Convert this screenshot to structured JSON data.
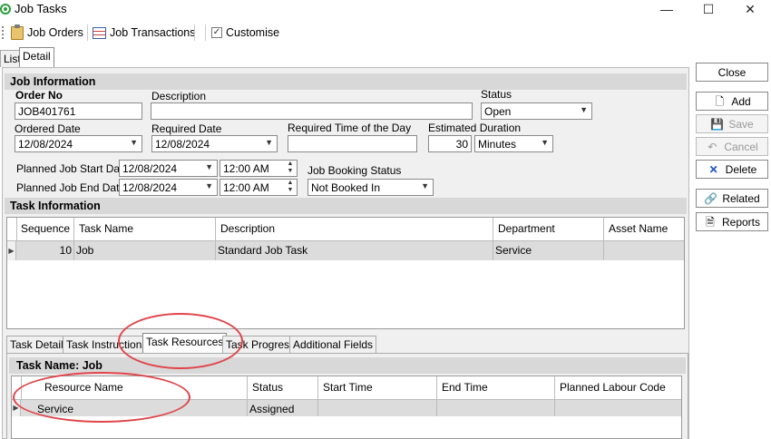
{
  "window": {
    "title": "Job Tasks",
    "minimize": "—",
    "maximize": "☐",
    "close": "✕"
  },
  "toolbar": {
    "job_orders": "Job Orders",
    "job_transactions": "Job Transactions",
    "customise": "Customise"
  },
  "top_tabs": {
    "list": "List",
    "detail": "Detail"
  },
  "job_info": {
    "section": "Job Information",
    "order_no_label": "Order No",
    "order_no": "JOB401761",
    "description_label": "Description",
    "description": "",
    "status_label": "Status",
    "status": "Open",
    "ordered_date_label": "Ordered Date",
    "ordered_date": "12/08/2024",
    "required_date_label": "Required Date",
    "required_date": "12/08/2024",
    "required_time_label": "Required Time of the Day",
    "required_time": "",
    "estimated_duration_label": "Estimated Duration",
    "estimated_duration": "30",
    "duration_unit": "Minutes",
    "planned_start_label": "Planned Job Start Date",
    "planned_start_date": "12/08/2024",
    "planned_start_time": "12:00 AM",
    "planned_end_label": "Planned Job End Date",
    "planned_end_date": "12/08/2024",
    "planned_end_time": "12:00 AM",
    "booking_status_label": "Job Booking Status",
    "booking_status": "Not Booked In"
  },
  "task_info": {
    "section": "Task Information",
    "columns": [
      "Sequence",
      "Task Name",
      "Description",
      "Department",
      "Asset Name"
    ],
    "rows": [
      {
        "sequence": "10",
        "task_name": "Job",
        "description": "Standard Job Task",
        "department": "Service",
        "asset_name": ""
      }
    ]
  },
  "bottom_tabs": [
    "Task Detail",
    "Task Instructions",
    "Task Resources",
    "Task Progress",
    "Additional Fields"
  ],
  "task_resources": {
    "header": "Task Name: Job",
    "columns": [
      "Resource Name",
      "Status",
      "Start Time",
      "End Time",
      "Planned Labour Code"
    ],
    "rows": [
      {
        "resource_name": "Service",
        "status": "Assigned",
        "start_time": "",
        "end_time": "",
        "planned_labour_code": ""
      }
    ]
  },
  "side_buttons": {
    "close": "Close",
    "add": "Add",
    "save": "Save",
    "cancel": "Cancel",
    "delete": "Delete",
    "related": "Related",
    "reports": "Reports"
  },
  "colors": {
    "highlight_ellipse": "#e0454a",
    "section_bar": "#d8d8d8"
  }
}
